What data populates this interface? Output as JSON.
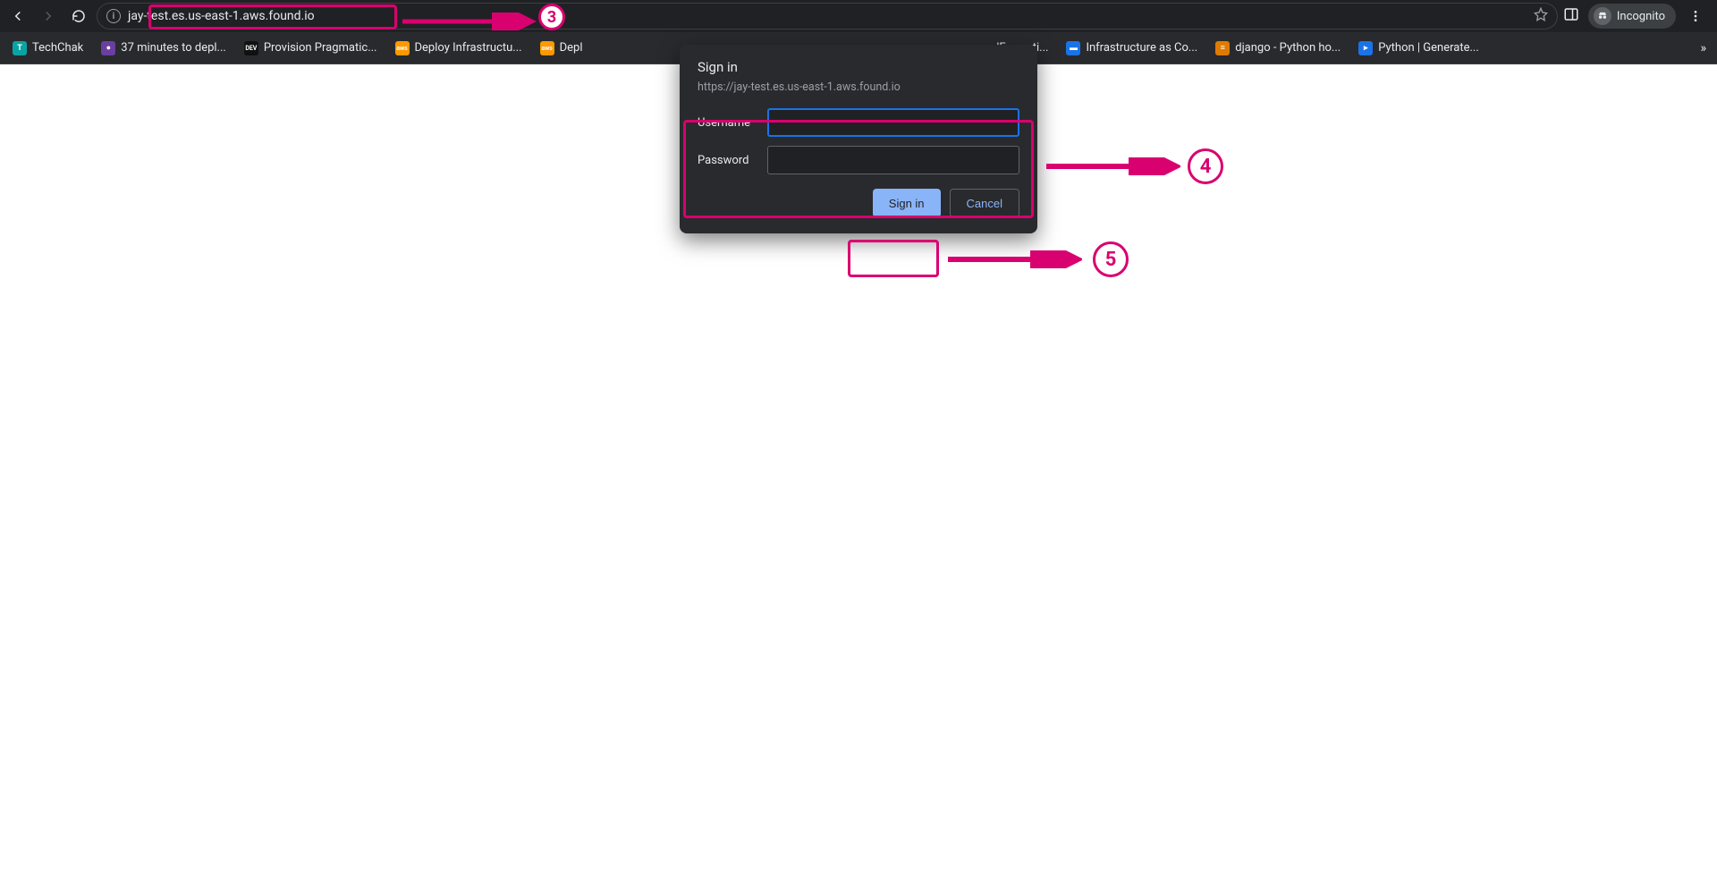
{
  "browser": {
    "url": "jay-test.es.us-east-1.aws.found.io",
    "incognito_label": "Incognito"
  },
  "bookmarks": [
    {
      "label": "TechChak",
      "color": "#0aa3a3",
      "glyph": "T"
    },
    {
      "label": "37 minutes to depl...",
      "color": "#6b3fa0",
      "glyph": "●"
    },
    {
      "label": "Provision Pragmatic...",
      "color": "#111",
      "glyph": "DEV"
    },
    {
      "label": "Deploy Infrastructu...",
      "color": "#f90",
      "glyph": "aws"
    },
    {
      "label": "Depl",
      "color": "#f90",
      "glyph": "aws"
    },
    {
      "label": "oudFormati...",
      "color": "#f90",
      "glyph": "aws"
    },
    {
      "label": "Infrastructure as Co...",
      "color": "#1a73e8",
      "glyph": "▬"
    },
    {
      "label": "django - Python ho...",
      "color": "#e07b00",
      "glyph": "≡"
    },
    {
      "label": "Python | Generate...",
      "color": "#1a73e8",
      "glyph": "▸"
    }
  ],
  "dialog": {
    "title": "Sign in",
    "origin": "https://jay-test.es.us-east-1.aws.found.io",
    "username_label": "Username",
    "password_label": "Password",
    "signin_label": "Sign in",
    "cancel_label": "Cancel"
  },
  "annotations": {
    "n3": "3",
    "n4": "4",
    "n5": "5"
  }
}
